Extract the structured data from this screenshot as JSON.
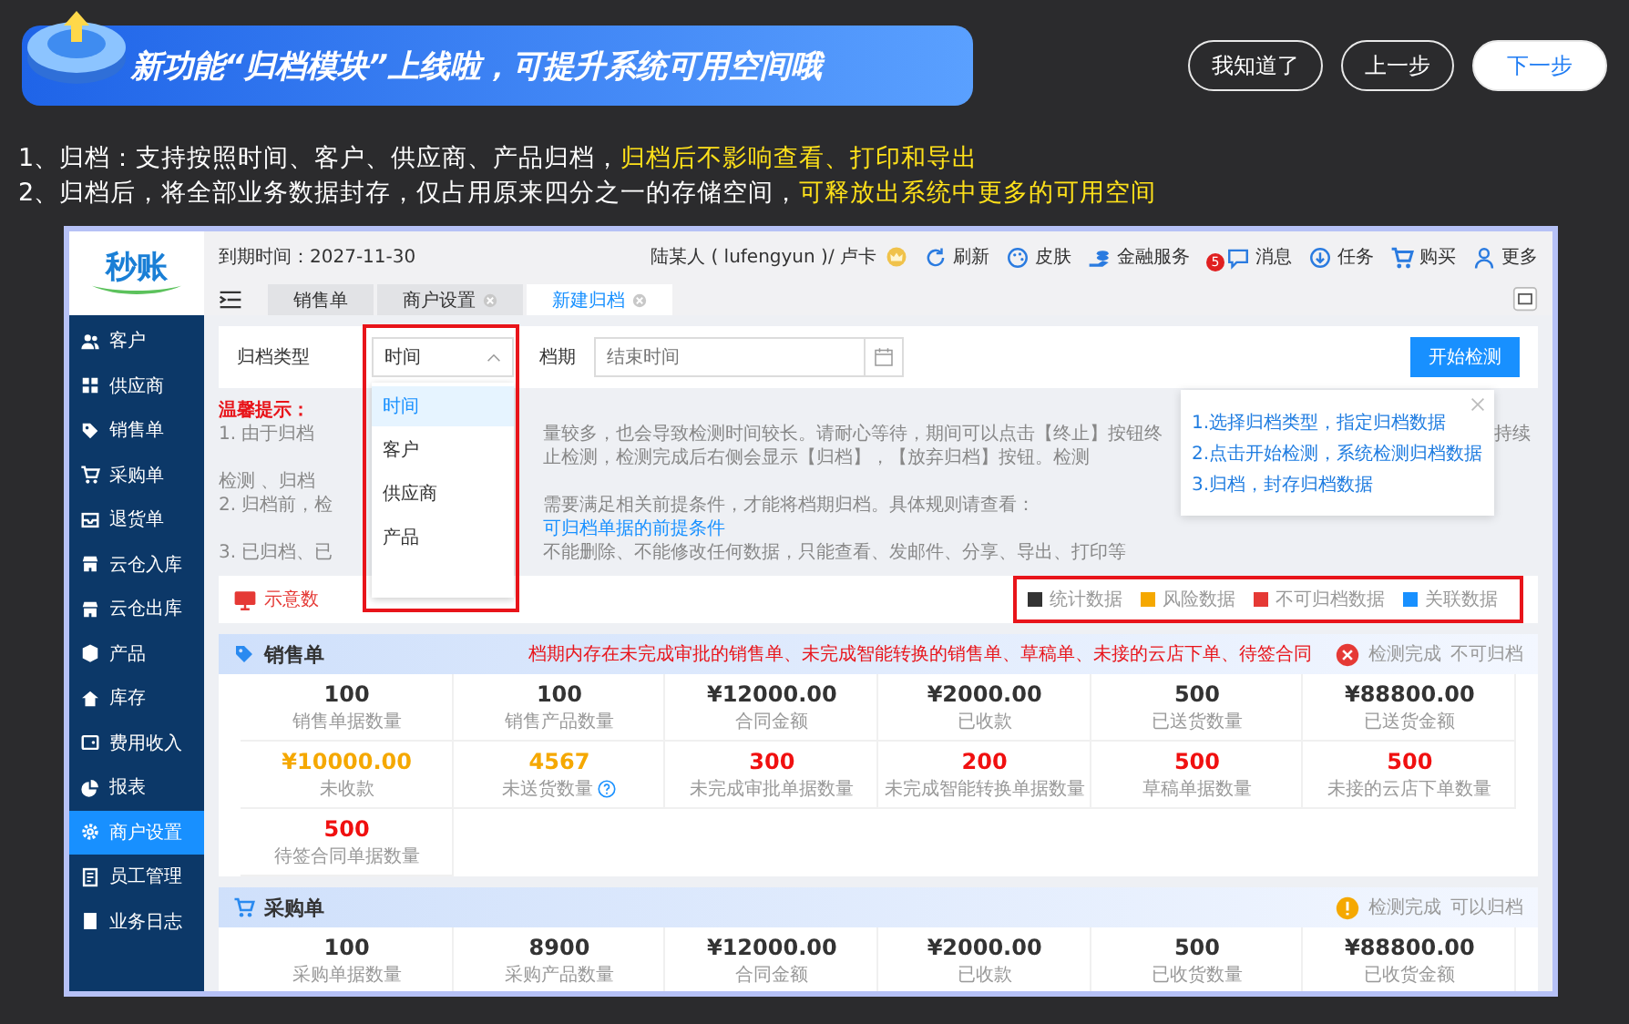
{
  "banner": {
    "title": "新功能“归档模块”上线啦，可提升系统可用空间哦"
  },
  "guide_buttons": [
    {
      "label": "我知道了",
      "primary": false
    },
    {
      "label": "上一步",
      "primary": false
    },
    {
      "label": "下一步",
      "primary": true
    }
  ],
  "instructions": [
    {
      "segments": [
        {
          "text": "1、归档：支持按照时间、客户、供应商、产品归档，",
          "highlight": false
        },
        {
          "text": "归档后不影响查看、打印和导出",
          "highlight": true
        }
      ]
    },
    {
      "segments": [
        {
          "text": "2、归档后，将全部业务数据封存，仅占用原来四分之一的存储空间，",
          "highlight": false
        },
        {
          "text": "可释放出系统中更多的可用空间",
          "highlight": true
        }
      ]
    }
  ],
  "app": {
    "logo": "秒账",
    "expiry": "到期时间：2027-11-30",
    "user": "陆某人 ( lufengyun )/ 卢卡",
    "toolbar": [
      {
        "label": "刷新"
      },
      {
        "label": "皮肤"
      },
      {
        "label": "金融服务"
      },
      {
        "label": "消息",
        "badge": "5"
      },
      {
        "label": "任务"
      },
      {
        "label": "购买"
      },
      {
        "label": "更多"
      }
    ],
    "tabs": [
      {
        "label": "销售单",
        "selected": false,
        "closable": false
      },
      {
        "label": "商户设置",
        "selected": false,
        "closable": true
      },
      {
        "label": "新建归档",
        "selected": true,
        "closable": true
      }
    ],
    "sidebar": [
      {
        "label": "客户",
        "selected": false
      },
      {
        "label": "供应商",
        "selected": false
      },
      {
        "label": "销售单",
        "selected": false
      },
      {
        "label": "采购单",
        "selected": false
      },
      {
        "label": "退货单",
        "selected": false
      },
      {
        "label": "云仓入库",
        "selected": false
      },
      {
        "label": "云仓出库",
        "selected": false
      },
      {
        "label": "产品",
        "selected": false
      },
      {
        "label": "库存",
        "selected": false
      },
      {
        "label": "费用收入",
        "selected": false
      },
      {
        "label": "报表",
        "selected": false
      },
      {
        "label": "商户设置",
        "selected": true
      },
      {
        "label": "员工管理",
        "selected": false
      },
      {
        "label": "业务日志",
        "selected": false
      }
    ],
    "form": {
      "type_label": "归档类型",
      "type_value": "时间",
      "period_label": "档期",
      "period_placeholder": "结束时间",
      "start_button": "开始检测"
    },
    "type_options": [
      {
        "label": "时间",
        "selected": true
      },
      {
        "label": "客户",
        "selected": false
      },
      {
        "label": "供应商",
        "selected": false
      },
      {
        "label": "产品",
        "selected": false
      }
    ],
    "notes": {
      "title": "温馨提示：",
      "lines": [
        {
          "left": "1. 由于归档",
          "middle": "量较多，也会导致检测时间较长。请耐心等待，期间可以点击【终止】按钮终止检测，检测完成后右侧会显示【归档】，【放弃归档】按钮。检测",
          "right": "持续"
        },
        {
          "left": "检测 、归档"
        },
        {
          "left": "2. 归档前，检",
          "middle": "需要满足相关前提条件，才能将档期归档。具体规则请查看：",
          "link": "可归档单据的前提条件"
        },
        {
          "left": "3. 已归档、已",
          "middle": "不能删除、不能修改任何数据，只能查看、发邮件、分享、导出、打印等"
        }
      ]
    },
    "guide_steps": [
      "1.选择归档类型，指定归档数据",
      "2.点击开始检测，系统检测归档数据",
      "3.归档，封存归档数据"
    ],
    "diagram_label": "示意数",
    "legend": [
      {
        "label": "统计数据",
        "color": "#333333"
      },
      {
        "label": "风险数据",
        "color": "#f5a800"
      },
      {
        "label": "不可归档数据",
        "color": "#e53935"
      },
      {
        "label": "关联数据",
        "color": "#1890ff"
      }
    ],
    "sections": [
      {
        "title": "销售单",
        "kind": "error",
        "message": "档期内存在未完成审批的销售单、未完成智能转换的销售单、草稿单、未接的云店下单、待签合同",
        "status_text": "检测完成",
        "result_text": "不可归档",
        "stats": [
          {
            "value": "100",
            "label": "销售单据数量",
            "kind": "normal",
            "help": false
          },
          {
            "value": "100",
            "label": "销售产品数量",
            "kind": "normal",
            "help": false
          },
          {
            "value": "¥12000.00",
            "label": "合同金额",
            "kind": "normal",
            "help": false
          },
          {
            "value": "¥2000.00",
            "label": "已收款",
            "kind": "normal",
            "help": false
          },
          {
            "value": "500",
            "label": "已送货数量",
            "kind": "normal",
            "help": false
          },
          {
            "value": "¥88800.00",
            "label": "已送货金额",
            "kind": "normal",
            "help": false
          },
          {
            "value": "¥10000.00",
            "label": "未收款",
            "kind": "warning",
            "help": false
          },
          {
            "value": "4567",
            "label": "未送货数量",
            "kind": "warning",
            "help": true
          },
          {
            "value": "300",
            "label": "未完成审批单据数量",
            "kind": "danger",
            "help": false
          },
          {
            "value": "200",
            "label": "未完成智能转换单据数量",
            "kind": "danger",
            "help": false
          },
          {
            "value": "500",
            "label": "草稿单据数量",
            "kind": "danger",
            "help": false
          },
          {
            "value": "500",
            "label": "未接的云店下单数量",
            "kind": "danger",
            "help": false
          },
          {
            "value": "500",
            "label": "待签合同单据数量",
            "kind": "danger",
            "help": false
          }
        ]
      },
      {
        "title": "采购单",
        "kind": "ok",
        "status_text": "检测完成",
        "result_text": "可以归档",
        "stats": [
          {
            "value": "100",
            "label": "采购单据数量",
            "kind": "normal",
            "help": false
          },
          {
            "value": "8900",
            "label": "采购产品数量",
            "kind": "normal",
            "help": false
          },
          {
            "value": "¥12000.00",
            "label": "合同金额",
            "kind": "normal",
            "help": false
          },
          {
            "value": "¥2000.00",
            "label": "已收款",
            "kind": "normal",
            "help": false
          },
          {
            "value": "500",
            "label": "已收货数量",
            "kind": "normal",
            "help": false
          },
          {
            "value": "¥88800.00",
            "label": "已收货金额",
            "kind": "normal",
            "help": false
          }
        ]
      }
    ]
  }
}
